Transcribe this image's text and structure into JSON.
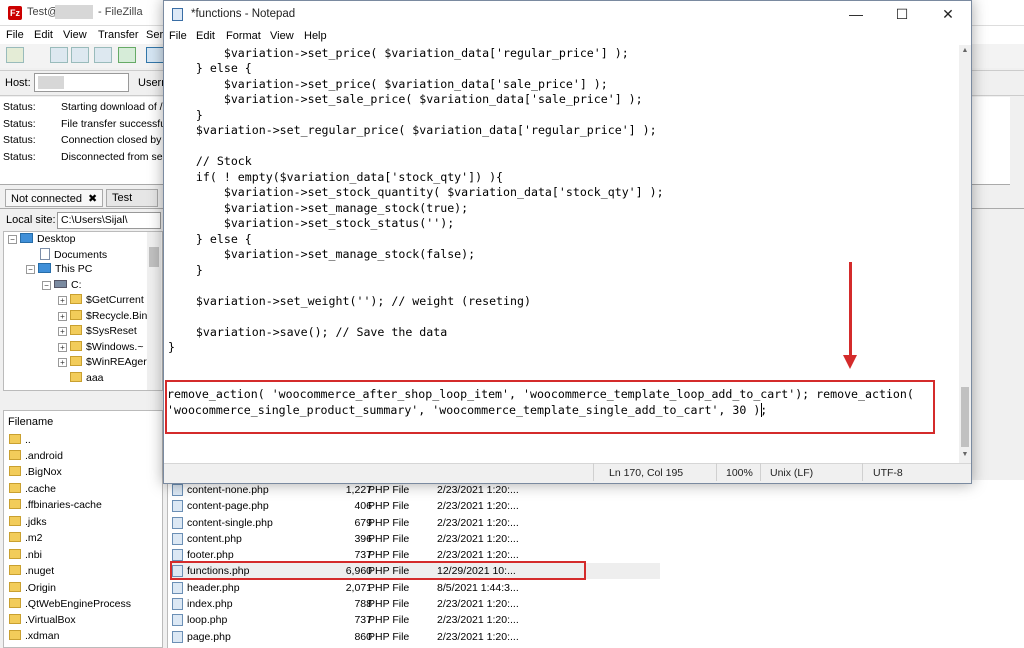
{
  "filezilla": {
    "title_prefix": "Test@",
    "title_app": "- FileZilla",
    "menu": [
      "File",
      "Edit",
      "View",
      "Transfer",
      "Ser"
    ],
    "host_label": "Host:",
    "user_label": "Usern",
    "log": [
      {
        "key": "Status:",
        "msg": "Starting download of /"
      },
      {
        "key": "Status:",
        "msg": "File transfer successfu"
      },
      {
        "key": "Status:",
        "msg": "Connection closed by"
      },
      {
        "key": "Status:",
        "msg": "Disconnected from se"
      }
    ],
    "tabs": {
      "tab1": "Not connected",
      "tab1_close": "✖",
      "tab2": "Test"
    },
    "local_site_label": "Local site:",
    "local_site_value": "C:\\Users\\Sijal\\",
    "tree": {
      "desktop": "Desktop",
      "documents": "Documents",
      "this_pc": "This PC",
      "drive": "C:",
      "folders": [
        "$GetCurrent",
        "$Recycle.Bin",
        "$SysReset",
        "$Windows.~",
        "$WinREAger",
        "aaa"
      ]
    },
    "left_files_header": "Filename",
    "left_files": [
      "..",
      ".android",
      ".BigNox",
      ".cache",
      ".ffbinaries-cache",
      ".jdks",
      ".m2",
      ".nbi",
      ".nuget",
      ".Origin",
      ".QtWebEngineProcess",
      ".VirtualBox",
      ".xdman"
    ],
    "remote_files": [
      {
        "name": "content-none.php",
        "size": "1,227",
        "type": "PHP File",
        "date": "2/23/2021 1:20:..."
      },
      {
        "name": "content-page.php",
        "size": "406",
        "type": "PHP File",
        "date": "2/23/2021 1:20:..."
      },
      {
        "name": "content-single.php",
        "size": "679",
        "type": "PHP File",
        "date": "2/23/2021 1:20:..."
      },
      {
        "name": "content.php",
        "size": "396",
        "type": "PHP File",
        "date": "2/23/2021 1:20:..."
      },
      {
        "name": "footer.php",
        "size": "737",
        "type": "PHP File",
        "date": "2/23/2021 1:20:..."
      },
      {
        "name": "functions.php",
        "size": "6,960",
        "type": "PHP File",
        "date": "12/29/2021 10:..."
      },
      {
        "name": "header.php",
        "size": "2,071",
        "type": "PHP File",
        "date": "8/5/2021 1:44:3..."
      },
      {
        "name": "index.php",
        "size": "788",
        "type": "PHP File",
        "date": "2/23/2021 1:20:..."
      },
      {
        "name": "loop.php",
        "size": "737",
        "type": "PHP File",
        "date": "2/23/2021 1:20:..."
      },
      {
        "name": "page.php",
        "size": "860",
        "type": "PHP File",
        "date": "2/23/2021 1:20:..."
      }
    ]
  },
  "notepad": {
    "title": "*functions - Notepad",
    "menu": [
      "File",
      "Edit",
      "Format",
      "View",
      "Help"
    ],
    "window_buttons": {
      "minimize": "—",
      "maximize": "☐",
      "close": "✕"
    },
    "code_lines": [
      "        $variation->set_price( $variation_data['regular_price'] );",
      "    } else {",
      "        $variation->set_price( $variation_data['sale_price'] );",
      "        $variation->set_sale_price( $variation_data['sale_price'] );",
      "    }",
      "    $variation->set_regular_price( $variation_data['regular_price'] );",
      "",
      "    // Stock",
      "    if( ! empty($variation_data['stock_qty']) ){",
      "        $variation->set_stock_quantity( $variation_data['stock_qty'] );",
      "        $variation->set_manage_stock(true);",
      "        $variation->set_stock_status('');",
      "    } else {",
      "        $variation->set_manage_stock(false);",
      "    }",
      "",
      "    $variation->set_weight(''); // weight (reseting)",
      "",
      "    $variation->save(); // Save the data",
      "}",
      "",
      "",
      "remove_action( 'woocommerce_after_shop_loop_item', 'woocommerce_template_loop_add_to_cart'); remove_action(",
      "'woocommerce_single_product_summary', 'woocommerce_template_single_add_to_cart', 30 );"
    ],
    "status": {
      "position": "Ln 170, Col 195",
      "zoom": "100%",
      "line_ending": "Unix (LF)",
      "encoding": "UTF-8"
    }
  },
  "colors": {
    "annotation_red": "#d42b2b"
  }
}
